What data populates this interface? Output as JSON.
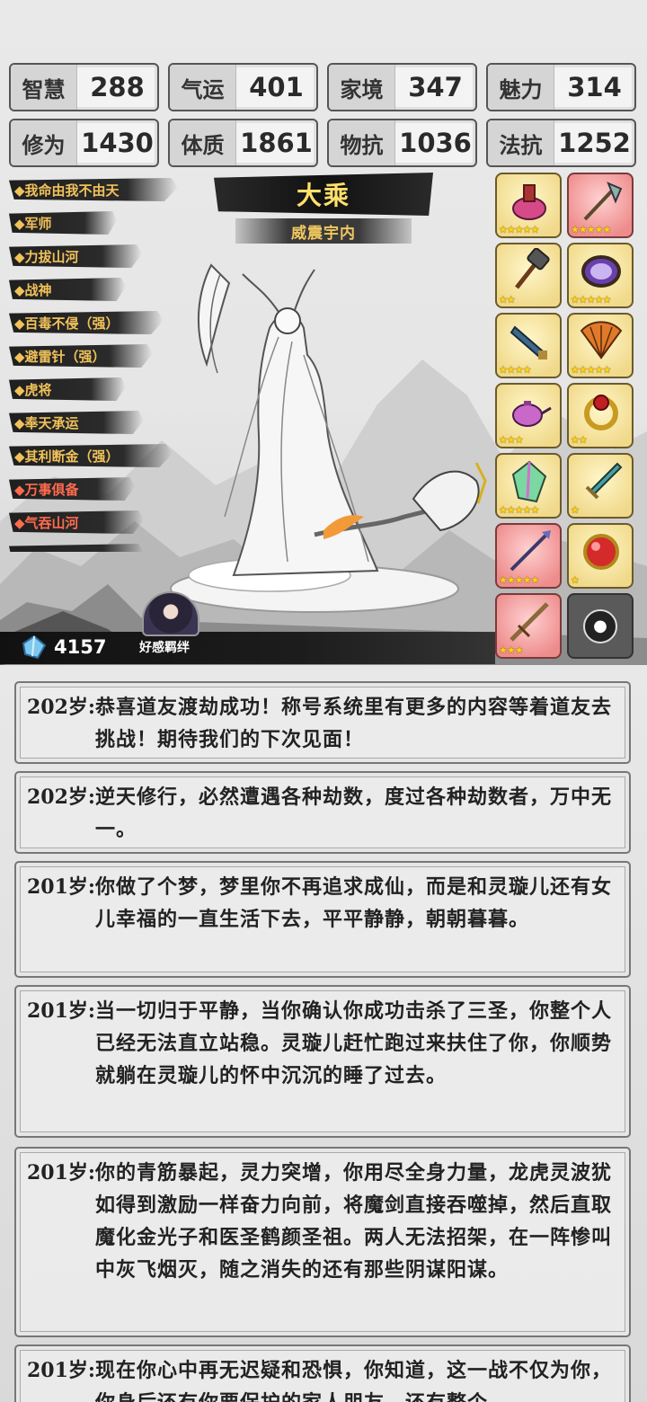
{
  "stats": [
    {
      "name": "智慧",
      "value": "288"
    },
    {
      "name": "气运",
      "value": "401"
    },
    {
      "name": "家境",
      "value": "347"
    },
    {
      "name": "魅力",
      "value": "314"
    },
    {
      "name": "修为",
      "value": "1430"
    },
    {
      "name": "体质",
      "value": "1861"
    },
    {
      "name": "物抗",
      "value": "1036"
    },
    {
      "name": "法抗",
      "value": "1252"
    }
  ],
  "traits": [
    {
      "label": "◆我命由我不由天",
      "color": "gold"
    },
    {
      "label": "◆军师",
      "color": "gold"
    },
    {
      "label": "◆力拔山河",
      "color": "gold"
    },
    {
      "label": "◆战神",
      "color": "gold"
    },
    {
      "label": "◆百毒不侵（强）",
      "color": "gold"
    },
    {
      "label": "◆避雷针（强）",
      "color": "gold"
    },
    {
      "label": "◆虎将",
      "color": "gold"
    },
    {
      "label": "◆奉天承运",
      "color": "gold"
    },
    {
      "label": "◆其利断金（强）",
      "color": "gold"
    },
    {
      "label": "◆万事俱备",
      "color": "red"
    },
    {
      "label": "◆气吞山河",
      "color": "red"
    }
  ],
  "realm": {
    "title": "大乘",
    "subtitle": "威震宇内"
  },
  "equipment": [
    {
      "icon": "magic-pot-icon",
      "rarity": "gold",
      "stars": "★★★★★"
    },
    {
      "icon": "halberd-icon",
      "rarity": "pink",
      "stars": "★★★★★"
    },
    {
      "icon": "war-hammer-icon",
      "rarity": "gold",
      "stars": "★★"
    },
    {
      "icon": "mirror-icon",
      "rarity": "gold",
      "stars": "★★★★★"
    },
    {
      "icon": "blade-icon",
      "rarity": "gold",
      "stars": "★★★★"
    },
    {
      "icon": "fan-icon",
      "rarity": "gold",
      "stars": "★★★★★"
    },
    {
      "icon": "teapot-icon",
      "rarity": "gold",
      "stars": "★★★"
    },
    {
      "icon": "ring-icon",
      "rarity": "gold",
      "stars": "★★"
    },
    {
      "icon": "crystal-icon",
      "rarity": "gold",
      "stars": "★★★★★"
    },
    {
      "icon": "sword-icon",
      "rarity": "gold",
      "stars": "★"
    },
    {
      "icon": "spear-icon",
      "rarity": "pink",
      "stars": "★★★★★"
    },
    {
      "icon": "orb-icon",
      "rarity": "gold",
      "stars": "★"
    },
    {
      "icon": "staff-icon",
      "rarity": "pink",
      "stars": "★★★"
    },
    {
      "icon": "lock-icon",
      "rarity": "locked",
      "stars": ""
    }
  ],
  "currency": {
    "spirit_stones": "4157"
  },
  "companion": {
    "label": "好感羁绊"
  },
  "log": [
    {
      "age": "202岁:",
      "text": "恭喜道友渡劫成功！称号系统里有更多的内容等着道友去挑战！期待我们的下次见面！"
    },
    {
      "age": "202岁:",
      "text": "逆天修行，必然遭遇各种劫数，度过各种劫数者，万中无一。"
    },
    {
      "age": "201岁:",
      "text": "你做了个梦，梦里你不再追求成仙，而是和灵璇儿还有女儿幸福的一直生活下去，平平静静，朝朝暮暮。"
    },
    {
      "age": "201岁:",
      "text": "当一切归于平静，当你确认你成功击杀了三圣，你整个人已经无法直立站稳。灵璇儿赶忙跑过来扶住了你，你顺势就躺在灵璇儿的怀中沉沉的睡了过去。"
    },
    {
      "age": "201岁:",
      "text": "你的青筋暴起，灵力突增，你用尽全身力量，龙虎灵波犹如得到激励一样奋力向前，将魔剑直接吞噬掉，然后直取魔化金光子和医圣鹤颜圣祖。两人无法招架，在一阵惨叫中灰飞烟灭，随之消失的还有那些阴谋阳谋。"
    },
    {
      "age": "201岁:",
      "text": "现在你心中再无迟疑和恐惧，你知道，这一战不仅为你，你身后还有你要保护的家人朋友，还有整个"
    }
  ]
}
